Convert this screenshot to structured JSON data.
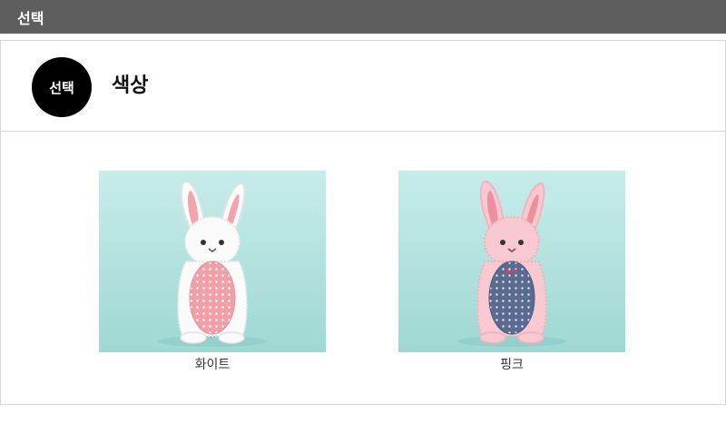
{
  "header": {
    "title": "선택"
  },
  "section": {
    "badge": "선택",
    "title": "색상"
  },
  "options": [
    {
      "label": "화이트",
      "image": "white-bunny-pink-dot-doll"
    },
    {
      "label": "핑크",
      "image": "pink-bunny-navy-dot-doll"
    }
  ],
  "colors": {
    "top_bar": "#5e5e5e",
    "badge": "#000000",
    "image_bg": "#bfe6e4"
  }
}
